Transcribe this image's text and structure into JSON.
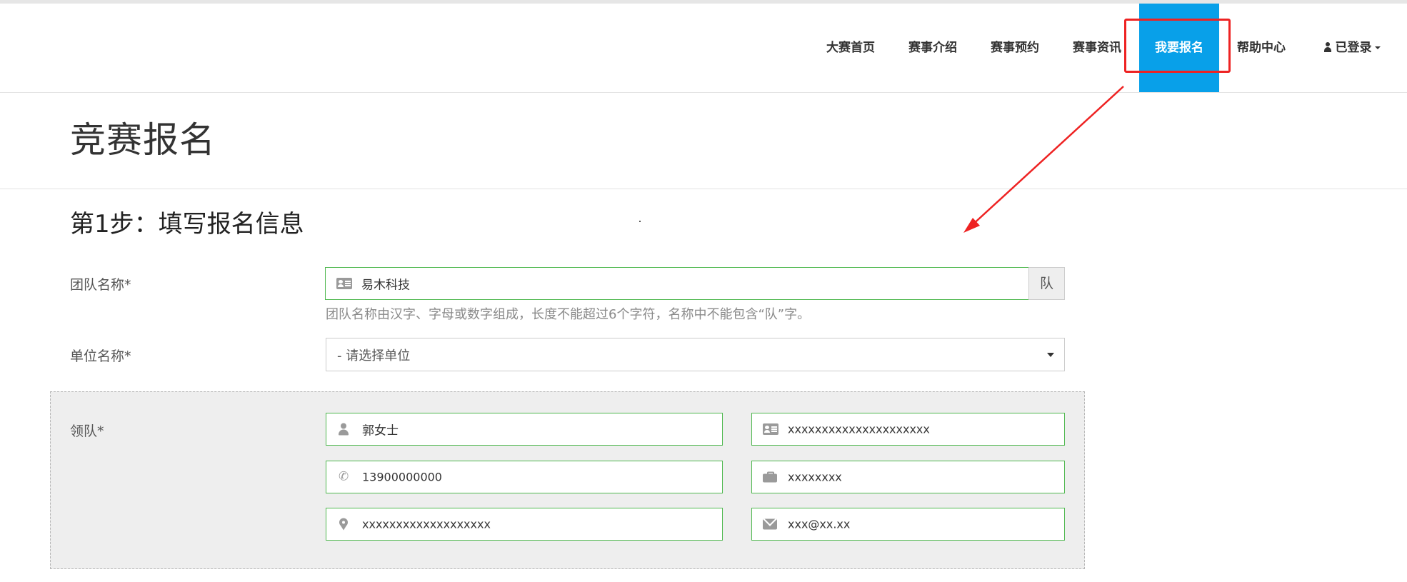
{
  "nav": {
    "items": [
      {
        "label": "大赛首页"
      },
      {
        "label": "赛事介绍"
      },
      {
        "label": "赛事预约"
      },
      {
        "label": "赛事资讯"
      },
      {
        "label": "我要报名",
        "active": true
      },
      {
        "label": "帮助中心"
      }
    ],
    "user_label": "已登录"
  },
  "page": {
    "title": "竞赛报名",
    "step_title": "第1步：填写报名信息"
  },
  "form": {
    "team_name": {
      "label": "团队名称*",
      "value": "易木科技",
      "addon": "队",
      "help": "团队名称由汉字、字母或数字组成，长度不能超过6个字符，名称中不能包含“队”字。"
    },
    "unit": {
      "label": "单位名称*",
      "selected": "- 请选择单位"
    },
    "leader": {
      "label": "领队*",
      "name": "郭女士",
      "id_card": "xxxxxxxxxxxxxxxxxxxxx",
      "phone": "13900000000",
      "job": "xxxxxxxx",
      "address": "xxxxxxxxxxxxxxxxxxx",
      "email": "xxx@xx.xx"
    }
  },
  "annotation_color": "#ee2222",
  "accent_color": "#08a0e9"
}
